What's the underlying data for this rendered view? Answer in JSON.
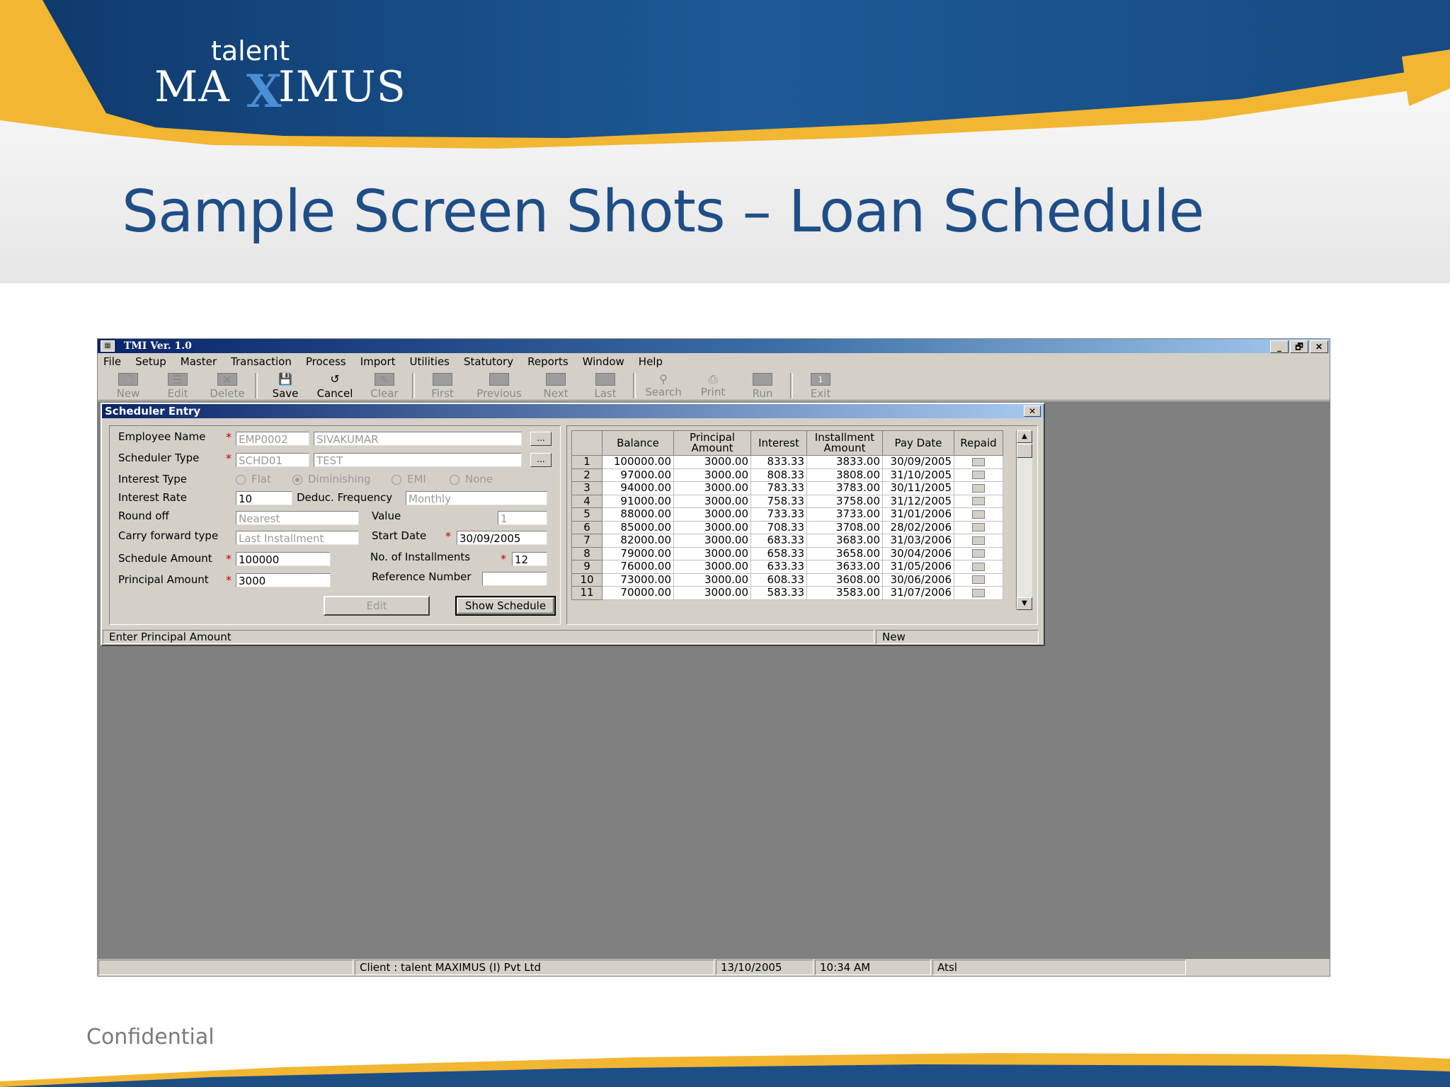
{
  "slide": {
    "logo_small": "talent",
    "logo_left": "MA",
    "logo_x": "X",
    "logo_right": "IMUS",
    "title": "Sample Screen Shots – Loan Schedule",
    "footer": "Confidential",
    "colors": {
      "title": "#1f4e87",
      "header_blue": "#1d4f86",
      "accent_gold": "#f2b632"
    }
  },
  "app": {
    "title": "TMI Ver. 1.0",
    "window_buttons": [
      "_",
      "🗗",
      "✕"
    ],
    "menu": [
      "File",
      "Setup",
      "Master",
      "Transaction",
      "Process",
      "Import",
      "Utilities",
      "Statutory",
      "Reports",
      "Window",
      "Help"
    ],
    "toolbar": [
      {
        "label": "New",
        "icon": "new-doc-icon",
        "glyph": "🗋",
        "enabled": false
      },
      {
        "label": "Edit",
        "icon": "edit-icon",
        "glyph": "☰",
        "enabled": false
      },
      {
        "label": "Delete",
        "icon": "delete-icon",
        "glyph": "✕",
        "enabled": false
      },
      {
        "label": "Save",
        "icon": "save-icon",
        "glyph": "💾",
        "enabled": true
      },
      {
        "label": "Cancel",
        "icon": "cancel-icon",
        "glyph": "↺",
        "enabled": true
      },
      {
        "label": "Clear",
        "icon": "eraser-icon",
        "glyph": "✎",
        "enabled": false
      },
      {
        "label": "First",
        "icon": "first-icon",
        "glyph": "",
        "enabled": false
      },
      {
        "label": "Previous",
        "icon": "previous-icon",
        "glyph": "",
        "enabled": false
      },
      {
        "label": "Next",
        "icon": "next-icon",
        "glyph": "",
        "enabled": false
      },
      {
        "label": "Last",
        "icon": "last-icon",
        "glyph": "",
        "enabled": false
      },
      {
        "label": "Search",
        "icon": "binoculars-icon",
        "glyph": "⚲",
        "enabled": false
      },
      {
        "label": "Print",
        "icon": "printer-icon",
        "glyph": "⎙",
        "enabled": false
      },
      {
        "label": "Run",
        "icon": "run-icon",
        "glyph": "",
        "enabled": false
      },
      {
        "label": "Exit",
        "icon": "exit-icon",
        "glyph": "1",
        "enabled": false
      }
    ],
    "status": {
      "client": "Client :  talent MAXIMUS (I) Pvt Ltd",
      "date": "13/10/2005",
      "time": "10:34 AM",
      "user": "Atsl"
    }
  },
  "dialog": {
    "title": "Scheduler Entry",
    "close": "✕",
    "form": {
      "employee_name_label": "Employee Name",
      "employee_code": "EMP0002",
      "employee_name": "SIVAKUMAR",
      "scheduler_type_label": "Scheduler Type",
      "scheduler_code": "SCHD01",
      "scheduler_name": "TEST",
      "ellipsis": "...",
      "interest_type_label": "Interest Type",
      "interest_options": [
        "Flat",
        "Diminishing",
        "EMI",
        "None"
      ],
      "interest_selected": "Diminishing",
      "interest_rate_label": "Interest Rate",
      "interest_rate": "10",
      "deduc_frequency_label": "Deduc. Frequency",
      "deduc_frequency": "Monthly",
      "round_off_label": "Round off",
      "round_off": "Nearest",
      "value_label": "Value",
      "value": "1",
      "carry_forward_label": "Carry forward type",
      "carry_forward": "Last Installment",
      "start_date_label": "Start Date",
      "start_date": "30/09/2005",
      "schedule_amount_label": "Schedule Amount",
      "schedule_amount": "100000",
      "installments_label": "No. of Installments",
      "installments": "12",
      "principal_amount_label": "Principal Amount",
      "principal_amount": "3000",
      "reference_number_label": "Reference Number",
      "reference_number": "",
      "edit_button": "Edit",
      "show_schedule_button": "Show Schedule",
      "required_mark": "*"
    },
    "grid": {
      "headers": [
        "",
        "Balance",
        "Principal Amount",
        "Interest",
        "Installment Amount",
        "Pay Date",
        "Repaid"
      ],
      "rows": [
        [
          "1",
          "100000.00",
          "3000.00",
          "833.33",
          "3833.00",
          "30/09/2005"
        ],
        [
          "2",
          "97000.00",
          "3000.00",
          "808.33",
          "3808.00",
          "31/10/2005"
        ],
        [
          "3",
          "94000.00",
          "3000.00",
          "783.33",
          "3783.00",
          "30/11/2005"
        ],
        [
          "4",
          "91000.00",
          "3000.00",
          "758.33",
          "3758.00",
          "31/12/2005"
        ],
        [
          "5",
          "88000.00",
          "3000.00",
          "733.33",
          "3733.00",
          "31/01/2006"
        ],
        [
          "6",
          "85000.00",
          "3000.00",
          "708.33",
          "3708.00",
          "28/02/2006"
        ],
        [
          "7",
          "82000.00",
          "3000.00",
          "683.33",
          "3683.00",
          "31/03/2006"
        ],
        [
          "8",
          "79000.00",
          "3000.00",
          "658.33",
          "3658.00",
          "30/04/2006"
        ],
        [
          "9",
          "76000.00",
          "3000.00",
          "633.33",
          "3633.00",
          "31/05/2006"
        ],
        [
          "10",
          "73000.00",
          "3000.00",
          "608.33",
          "3608.00",
          "30/06/2006"
        ],
        [
          "11",
          "70000.00",
          "3000.00",
          "583.33",
          "3583.00",
          "31/07/2006"
        ]
      ]
    },
    "status_message": "Enter Principal Amount",
    "status_mode": "New"
  }
}
